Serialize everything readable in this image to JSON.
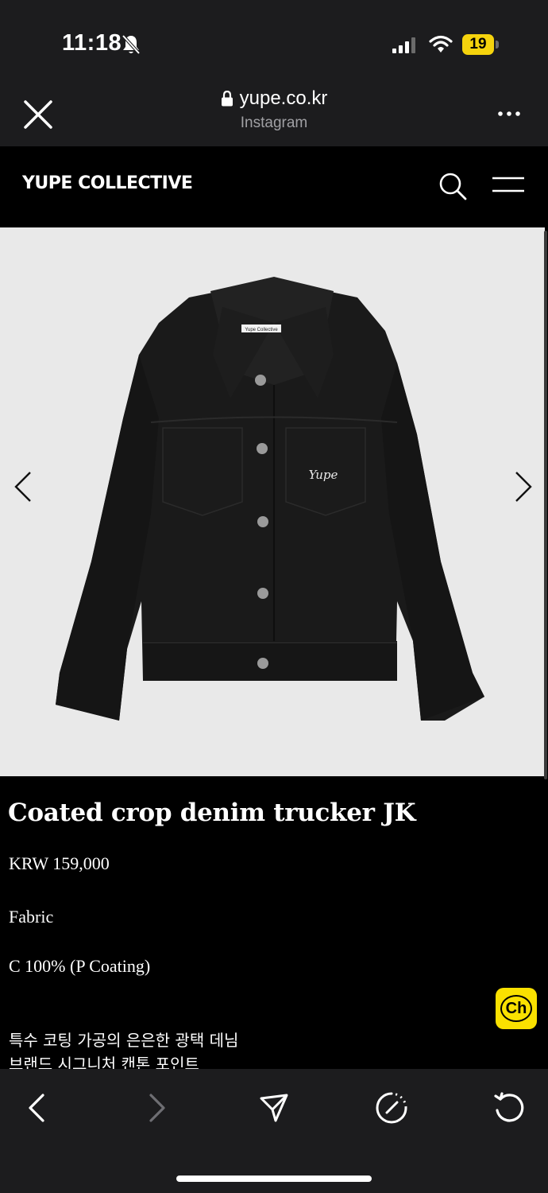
{
  "status_bar": {
    "time": "11:18",
    "battery_level": "19",
    "icons": [
      "bell-slash-icon",
      "signal-icon",
      "wifi-icon",
      "battery-icon"
    ],
    "battery_color": "#f5d30d"
  },
  "browser": {
    "url": "yupe.co.kr",
    "source": "Instagram",
    "icons": [
      "close-icon",
      "lock-icon",
      "more-icon"
    ]
  },
  "site_nav": {
    "brand": "YUPE COLLECTIVE",
    "icons": [
      "search-icon",
      "menu-icon"
    ]
  },
  "gallery": {
    "label_tag": "Yupe Collective",
    "embroidery": "Yupe",
    "icons": [
      "chevron-left-icon",
      "chevron-right-icon"
    ],
    "background": "#e9e9e9"
  },
  "product": {
    "title": "Coated crop denim trucker JK",
    "price": "KRW 159,000",
    "fabric_label": "Fabric",
    "fabric_value": "C 100% (P Coating)",
    "description": [
      "특수 코팅 가공의 은은한 광택 데님",
      "브랜드 시그니처 캔톤 포인트"
    ]
  },
  "chat_button": {
    "label": "Ch",
    "color": "#fae100"
  },
  "toolbar": {
    "icons": [
      "back-icon",
      "forward-icon",
      "share-icon",
      "compass-icon",
      "reload-icon"
    ]
  }
}
